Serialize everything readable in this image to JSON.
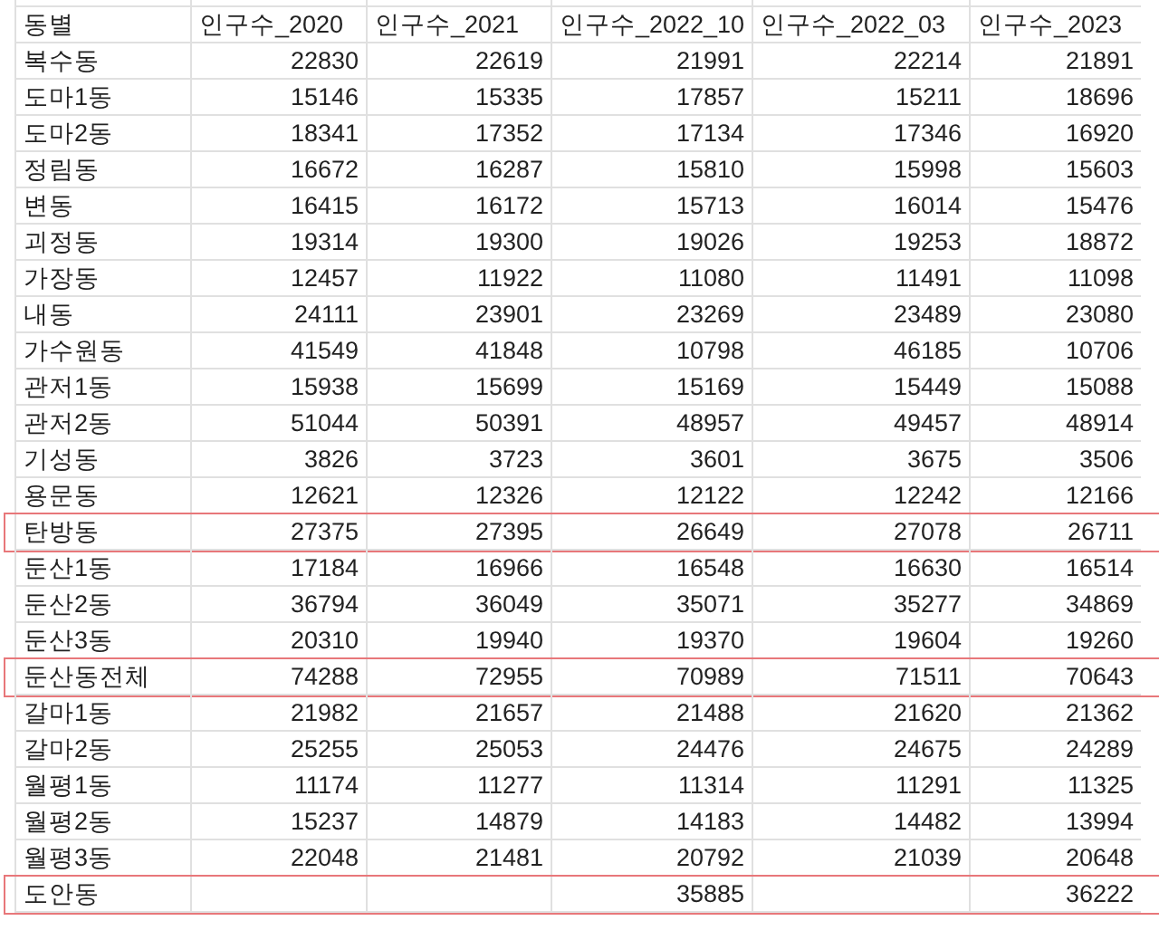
{
  "table": {
    "columns": [
      "동별",
      "인구수_2020",
      "인구수_2021",
      "인구수_2022_10",
      "인구수_2022_03",
      "인구수_2023"
    ],
    "rows": [
      {
        "cells": [
          "복수동",
          "22830",
          "22619",
          "21991",
          "22214",
          "21891"
        ],
        "highlighted": false
      },
      {
        "cells": [
          "도마1동",
          "15146",
          "15335",
          "17857",
          "15211",
          "18696"
        ],
        "highlighted": false
      },
      {
        "cells": [
          "도마2동",
          "18341",
          "17352",
          "17134",
          "17346",
          "16920"
        ],
        "highlighted": false
      },
      {
        "cells": [
          "정림동",
          "16672",
          "16287",
          "15810",
          "15998",
          "15603"
        ],
        "highlighted": false
      },
      {
        "cells": [
          "변동",
          "16415",
          "16172",
          "15713",
          "16014",
          "15476"
        ],
        "highlighted": false
      },
      {
        "cells": [
          "괴정동",
          "19314",
          "19300",
          "19026",
          "19253",
          "18872"
        ],
        "highlighted": false
      },
      {
        "cells": [
          "가장동",
          "12457",
          "11922",
          "11080",
          "11491",
          "11098"
        ],
        "highlighted": false
      },
      {
        "cells": [
          "내동",
          "24111",
          "23901",
          "23269",
          "23489",
          "23080"
        ],
        "highlighted": false
      },
      {
        "cells": [
          "가수원동",
          "41549",
          "41848",
          "10798",
          "46185",
          "10706"
        ],
        "highlighted": false
      },
      {
        "cells": [
          "관저1동",
          "15938",
          "15699",
          "15169",
          "15449",
          "15088"
        ],
        "highlighted": false
      },
      {
        "cells": [
          "관저2동",
          "51044",
          "50391",
          "48957",
          "49457",
          "48914"
        ],
        "highlighted": false
      },
      {
        "cells": [
          "기성동",
          "3826",
          "3723",
          "3601",
          "3675",
          "3506"
        ],
        "highlighted": false
      },
      {
        "cells": [
          "용문동",
          "12621",
          "12326",
          "12122",
          "12242",
          "12166"
        ],
        "highlighted": false
      },
      {
        "cells": [
          "탄방동",
          "27375",
          "27395",
          "26649",
          "27078",
          "26711"
        ],
        "highlighted": true
      },
      {
        "cells": [
          "둔산1동",
          "17184",
          "16966",
          "16548",
          "16630",
          "16514"
        ],
        "highlighted": false
      },
      {
        "cells": [
          "둔산2동",
          "36794",
          "36049",
          "35071",
          "35277",
          "34869"
        ],
        "highlighted": false
      },
      {
        "cells": [
          "둔산3동",
          "20310",
          "19940",
          "19370",
          "19604",
          "19260"
        ],
        "highlighted": false
      },
      {
        "cells": [
          "둔산동전체",
          "74288",
          "72955",
          "70989",
          "71511",
          "70643"
        ],
        "highlighted": true
      },
      {
        "cells": [
          "갈마1동",
          "21982",
          "21657",
          "21488",
          "21620",
          "21362"
        ],
        "highlighted": false
      },
      {
        "cells": [
          "갈마2동",
          "25255",
          "25053",
          "24476",
          "24675",
          "24289"
        ],
        "highlighted": false
      },
      {
        "cells": [
          "월평1동",
          "11174",
          "11277",
          "11314",
          "11291",
          "11325"
        ],
        "highlighted": false
      },
      {
        "cells": [
          "월평2동",
          "15237",
          "14879",
          "14183",
          "14482",
          "13994"
        ],
        "highlighted": false
      },
      {
        "cells": [
          "월평3동",
          "22048",
          "21481",
          "20792",
          "21039",
          "20648"
        ],
        "highlighted": false
      },
      {
        "cells": [
          "도안동",
          null,
          null,
          "35885",
          null,
          "36222"
        ],
        "highlighted": true
      }
    ]
  }
}
